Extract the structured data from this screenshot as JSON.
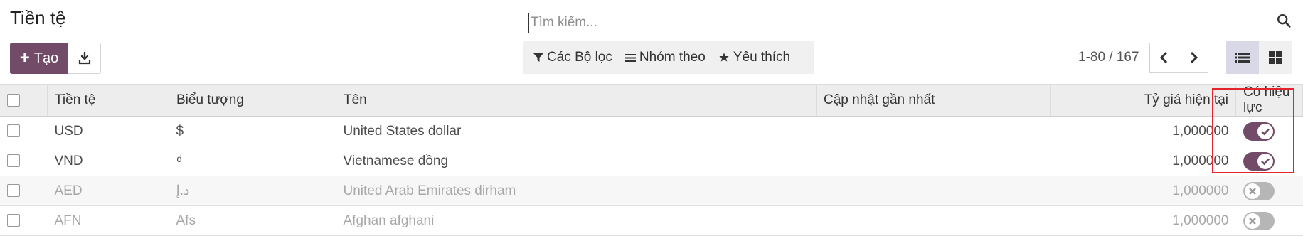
{
  "page": {
    "title": "Tiền tệ"
  },
  "search": {
    "placeholder": "Tìm kiếm..."
  },
  "toolbar": {
    "create_label": "Tạo"
  },
  "filters": {
    "filter_label": "Các Bộ lọc",
    "group_label": "Nhóm theo",
    "favorite_label": "Yêu thích"
  },
  "pager": {
    "range": "1-80 / 167"
  },
  "table": {
    "headers": {
      "code": "Tiền tệ",
      "symbol": "Biểu tượng",
      "name": "Tên",
      "updated": "Cập nhật gần nhất",
      "rate": "Tỷ giá hiện tại",
      "active": "Có hiệu lực"
    },
    "rows": [
      {
        "code": "USD",
        "symbol": "$",
        "name": "United States dollar",
        "updated": "",
        "rate": "1,000000",
        "active": true
      },
      {
        "code": "VND",
        "symbol": "₫",
        "name": "Vietnamese đồng",
        "updated": "",
        "rate": "1,000000",
        "active": true
      },
      {
        "code": "AED",
        "symbol": "د.إ",
        "name": "United Arab Emirates dirham",
        "updated": "",
        "rate": "1,000000",
        "active": false
      },
      {
        "code": "AFN",
        "symbol": "Afs",
        "name": "Afghan afghani",
        "updated": "",
        "rate": "1,000000",
        "active": false
      }
    ]
  },
  "colors": {
    "brand": "#714b67",
    "highlight": "#e3242b",
    "inactive_text": "#a8a8a8"
  },
  "icons": {
    "search": "search-icon",
    "plus": "plus-icon",
    "download": "download-icon",
    "filter": "filter-icon",
    "group": "list-lines-icon",
    "favorite": "star-icon",
    "prev": "chevron-left-icon",
    "next": "chevron-right-icon",
    "list_view": "list-view-icon",
    "kanban_view": "kanban-view-icon",
    "check": "check-icon",
    "cross": "x-icon"
  }
}
